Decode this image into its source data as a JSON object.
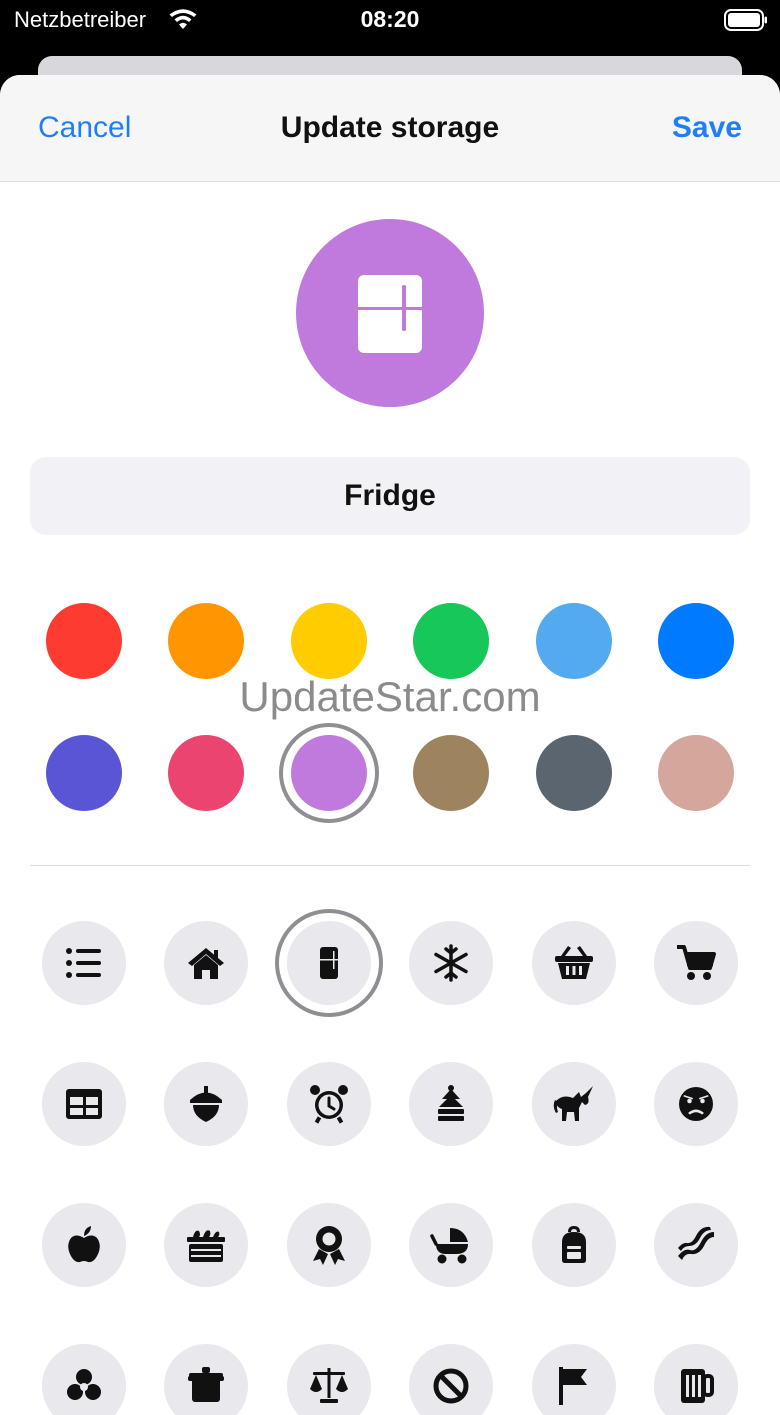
{
  "status_bar": {
    "carrier": "Netzbetreiber",
    "time": "08:20"
  },
  "nav": {
    "cancel_label": "Cancel",
    "title": "Update storage",
    "save_label": "Save"
  },
  "storage": {
    "name": "Fridge",
    "selected_color": "#c07ade",
    "selected_icon": "fridge-icon"
  },
  "colors": [
    "#fe3b30",
    "#ff9500",
    "#ffcc00",
    "#17c759",
    "#53aaef",
    "#007aff",
    "#5a55d5",
    "#ec4470",
    "#c07ade",
    "#9d845f",
    "#5b6570",
    "#d5a69c"
  ],
  "icons": [
    "list-icon",
    "home-icon",
    "fridge-icon",
    "snowflake-icon",
    "basket-icon",
    "cart-icon",
    "table-icon",
    "acorn-icon",
    "alarm-clock-icon",
    "tree-icon",
    "unicorn-icon",
    "angry-face-icon",
    "apple-icon",
    "crate-icon",
    "award-icon",
    "stroller-icon",
    "backpack-icon",
    "bacon-icon",
    "biohazard-icon",
    "suitcase-icon",
    "scale-icon",
    "ban-icon",
    "flag-icon",
    "beer-icon"
  ],
  "watermark": "UpdateStar.com"
}
